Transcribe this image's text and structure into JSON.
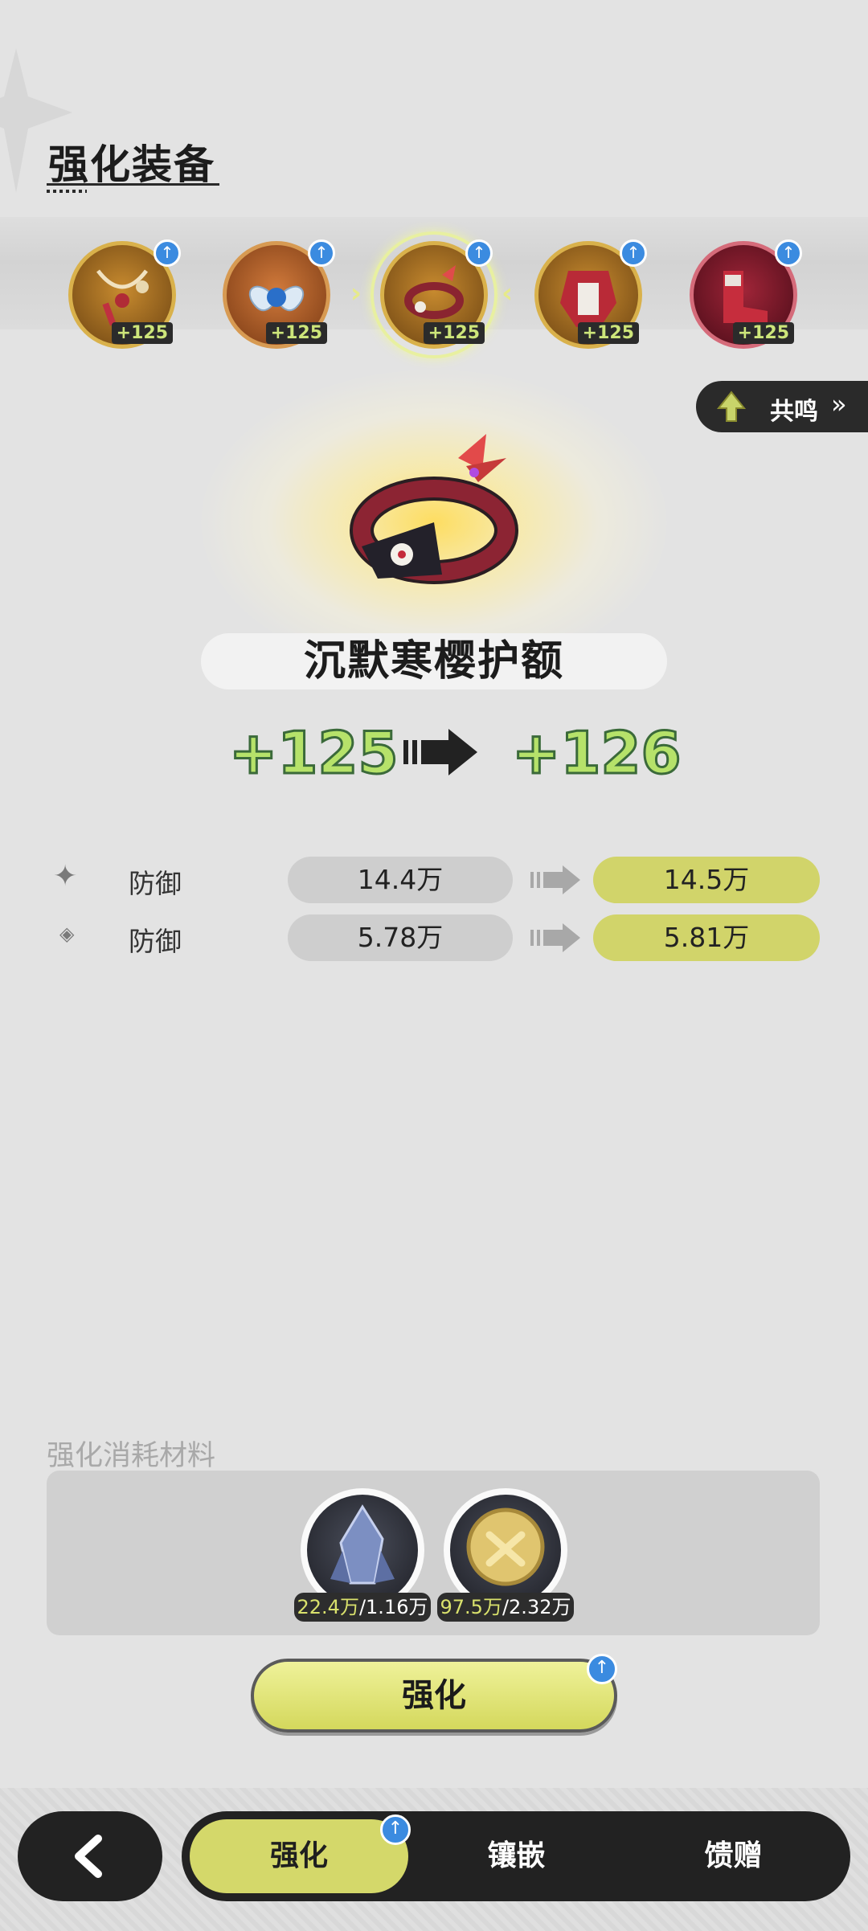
{
  "header": {
    "title": "强化装备"
  },
  "equipment_slots": [
    {
      "level": "+125",
      "icon": "necklace-icon",
      "upgrade_available": true
    },
    {
      "level": "+125",
      "icon": "crest-orb-icon",
      "upgrade_available": true
    },
    {
      "level": "+125",
      "icon": "headband-icon",
      "upgrade_available": true,
      "selected": true
    },
    {
      "level": "+125",
      "icon": "armor-icon",
      "upgrade_available": true
    },
    {
      "level": "+125",
      "icon": "boots-icon",
      "upgrade_available": true
    }
  ],
  "resonance": {
    "label": "共鸣",
    "arrow": "»"
  },
  "selected_item": {
    "name": "沉默寒樱护额",
    "level_from": "+125",
    "level_to": "+126"
  },
  "stats": [
    {
      "icon": "four-point-star-icon",
      "label": "防御",
      "current": "14.4万",
      "next": "14.5万"
    },
    {
      "icon": "diamond-outline-icon",
      "label": "防御",
      "current": "5.78万",
      "next": "5.81万"
    }
  ],
  "materials": {
    "title": "强化消耗材料",
    "items": [
      {
        "icon": "crystal-ore-icon",
        "have": "22.4万",
        "need": "/1.16万"
      },
      {
        "icon": "gold-coin-icon",
        "have": "97.5万",
        "need": "/2.32万"
      }
    ]
  },
  "actions": {
    "enhance_label": "强化"
  },
  "bottom_nav": {
    "back_icon": "chevron-left-icon",
    "tabs": [
      {
        "label": "强化",
        "active": true
      },
      {
        "label": "镶嵌",
        "active": false
      },
      {
        "label": "馈赠",
        "active": false
      }
    ]
  },
  "colors": {
    "accent": "#d4d86a",
    "upgrade_badge": "#3b8be0",
    "level_text": "#b6e26a"
  }
}
